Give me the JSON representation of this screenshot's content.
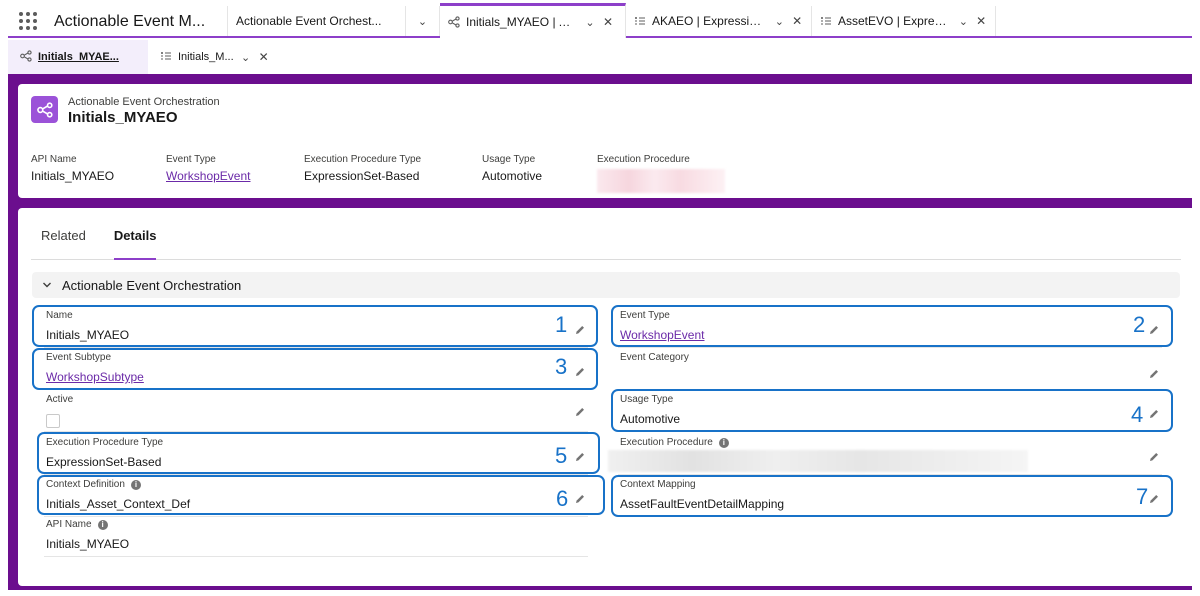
{
  "app": {
    "name": "Actionable Event M..."
  },
  "workspace_tabs": [
    {
      "label": "Actionable Event Orchest..."
    },
    {
      "label": "Initials_MYAEO | Ac..."
    },
    {
      "label": "AKAEO | Expression..."
    },
    {
      "label": "AssetEVO | Express..."
    }
  ],
  "subtabs": [
    {
      "label": "Initials_MYAE..."
    },
    {
      "label": "Initials_M..."
    }
  ],
  "header": {
    "object_type": "Actionable Event Orchestration",
    "title": "Initials_MYAEO",
    "fields": [
      {
        "label": "API Name",
        "value": "Initials_MYAEO"
      },
      {
        "label": "Event Type",
        "value": "WorkshopEvent"
      },
      {
        "label": "Execution Procedure Type",
        "value": "ExpressionSet-Based"
      },
      {
        "label": "Usage Type",
        "value": "Automotive"
      },
      {
        "label": "Execution Procedure",
        "value": ""
      }
    ]
  },
  "tabs": [
    {
      "label": "Related"
    },
    {
      "label": "Details"
    }
  ],
  "section": {
    "title": "Actionable Event Orchestration"
  },
  "fields": {
    "name": {
      "label": "Name",
      "value": "Initials_MYAEO"
    },
    "event_type": {
      "label": "Event Type",
      "value": "WorkshopEvent"
    },
    "event_subtype": {
      "label": "Event Subtype",
      "value": "WorkshopSubtype"
    },
    "event_category": {
      "label": "Event Category",
      "value": ""
    },
    "active": {
      "label": "Active",
      "checked": false
    },
    "usage_type": {
      "label": "Usage Type",
      "value": "Automotive"
    },
    "exec_proc_type": {
      "label": "Execution Procedure Type",
      "value": "ExpressionSet-Based"
    },
    "exec_proc": {
      "label": "Execution Procedure",
      "value": ""
    },
    "context_def": {
      "label": "Context Definition",
      "value": "Initials_Asset_Context_Def"
    },
    "context_mapping": {
      "label": "Context Mapping",
      "value": "AssetFaultEventDetailMapping"
    },
    "api_name": {
      "label": "API Name",
      "value": "Initials_MYAEO"
    }
  },
  "callouts": [
    "1",
    "2",
    "3",
    "4",
    "5",
    "6",
    "7"
  ],
  "colors": {
    "accent": "#8d3fc9",
    "frame": "#6b0e8e",
    "callout": "#1872c8",
    "link": "#6b2aa8"
  }
}
